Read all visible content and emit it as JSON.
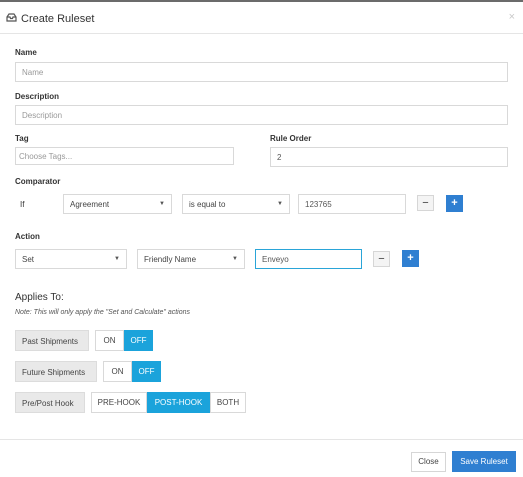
{
  "header": {
    "title": "Create Ruleset",
    "close_label": "×"
  },
  "form": {
    "name": {
      "label": "Name",
      "placeholder": "Name",
      "value": ""
    },
    "description": {
      "label": "Description",
      "placeholder": "Description",
      "value": ""
    },
    "tag": {
      "label": "Tag",
      "placeholder": "Choose Tags..."
    },
    "rule_order": {
      "label": "Rule Order",
      "value": "2"
    },
    "comparator": {
      "label": "Comparator",
      "prefix": "If",
      "field": "Agreement",
      "operator": "is equal to",
      "value": "123765"
    },
    "action": {
      "label": "Action",
      "type": "Set",
      "field": "Friendly Name",
      "value": "Enveyo"
    }
  },
  "applies": {
    "title": "Applies To:",
    "note": "Note: This will only apply the \"Set and Calculate\" actions",
    "past_shipments": {
      "label": "Past Shipments",
      "on": "ON",
      "off": "OFF",
      "selected": "OFF"
    },
    "future_shipments": {
      "label": "Future Shipments",
      "on": "ON",
      "off": "OFF",
      "selected": "OFF"
    },
    "hook": {
      "label": "Pre/Post Hook",
      "options": [
        "PRE-HOOK",
        "POST-HOOK",
        "BOTH"
      ],
      "selected": "POST-HOOK"
    }
  },
  "footer": {
    "close_label": "Close",
    "save_label": "Save Ruleset"
  },
  "icons": {
    "header": "inbox-tray-icon",
    "caret": "chevron-down-icon",
    "minus": "minus-icon",
    "plus": "plus-icon"
  },
  "colors": {
    "primary": "#2f7fd1",
    "toggle_active": "#1ba3db",
    "focus_border": "#2aa5d8"
  }
}
